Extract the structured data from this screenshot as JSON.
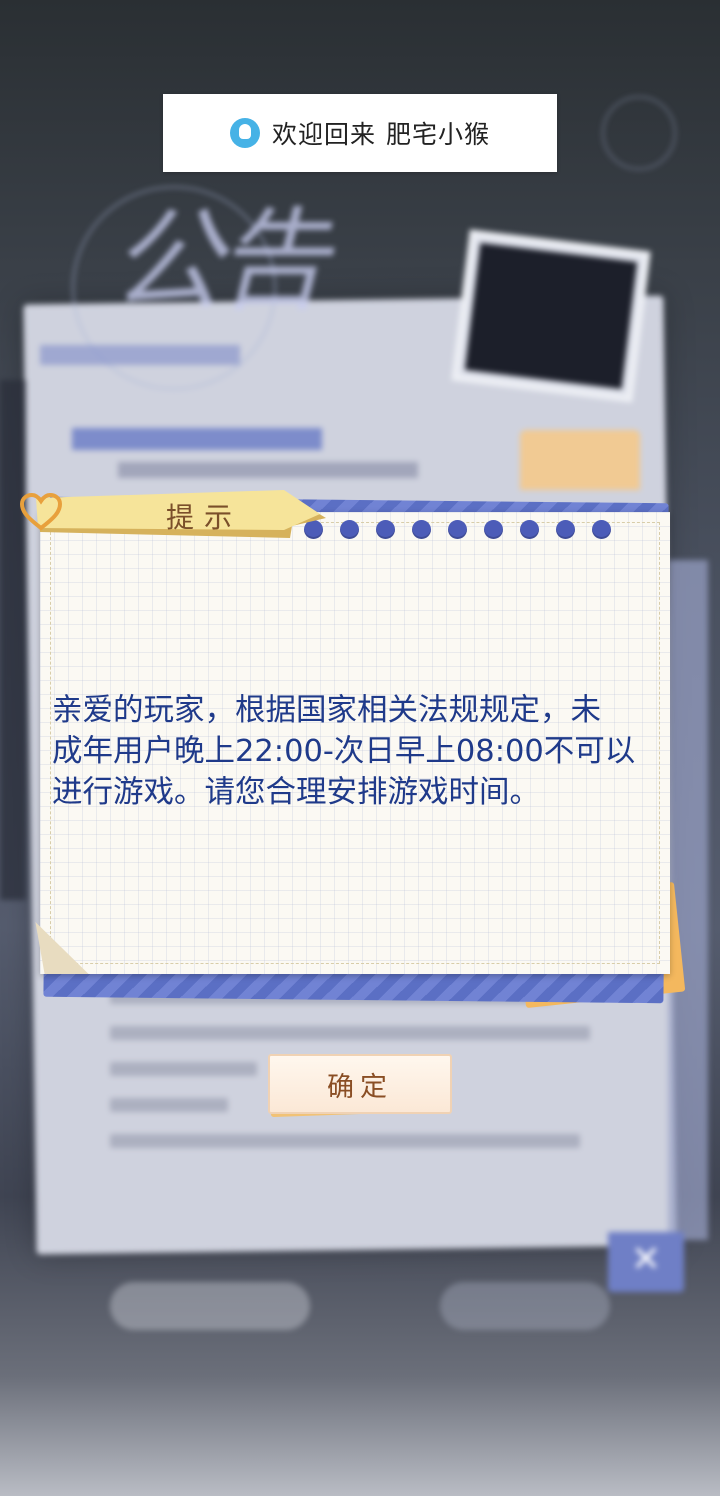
{
  "toast": {
    "greeting": "欢迎回来",
    "username": "肥宅小猴",
    "icon": "qq-penguin-icon"
  },
  "background": {
    "notice_title": "公告"
  },
  "dialog": {
    "title": "提示",
    "message": "亲爱的玩家，根据国家相关法规规定，未\n成年用户晚上22:00-次日早上08:00不可以\n进行游戏。请您合理安排游戏时间。",
    "confirm_label": "确定"
  },
  "colors": {
    "message_text": "#1f3a8a",
    "dot_blue": "#4c5cb8",
    "ribbon_yellow": "#f6e49a",
    "confirm_text": "#8a4e24"
  }
}
